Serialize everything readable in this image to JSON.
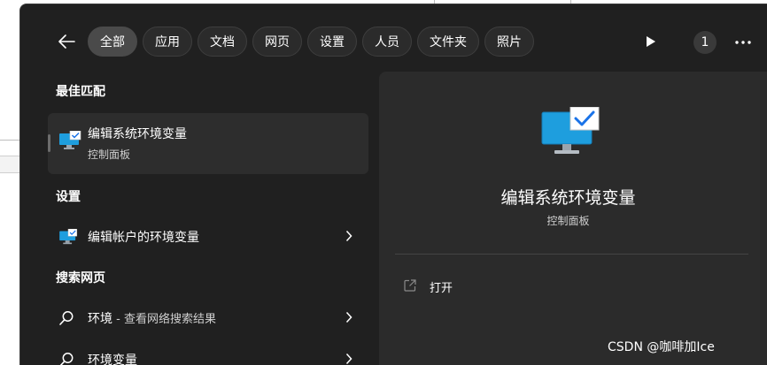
{
  "filters": {
    "items": [
      {
        "label": "全部",
        "active": true
      },
      {
        "label": "应用"
      },
      {
        "label": "文档"
      },
      {
        "label": "网页"
      },
      {
        "label": "设置"
      },
      {
        "label": "人员"
      },
      {
        "label": "文件夹"
      },
      {
        "label": "照片"
      }
    ],
    "badge_count": "1"
  },
  "best_match": {
    "header": "最佳匹配",
    "title": "编辑系统环境变量",
    "subtitle": "控制面板"
  },
  "settings": {
    "header": "设置",
    "items": [
      {
        "label": "编辑帐户的环境变量"
      }
    ]
  },
  "web_search": {
    "header": "搜索网页",
    "items": [
      {
        "label": "环境",
        "sub": " - 查看网络搜索结果"
      },
      {
        "label": "环境变量",
        "sub": ""
      }
    ]
  },
  "detail": {
    "title": "编辑系统环境变量",
    "subtitle": "控制面板",
    "actions": [
      {
        "label": "打开"
      }
    ]
  },
  "watermark": "CSDN @咖啡加Ice",
  "colors": {
    "panel": "#202020",
    "detail_panel": "#2b2b2b",
    "chip_active": "#4a4a4a",
    "monitor_blue": "#1e9ede",
    "check_blue": "#1a73e8"
  }
}
